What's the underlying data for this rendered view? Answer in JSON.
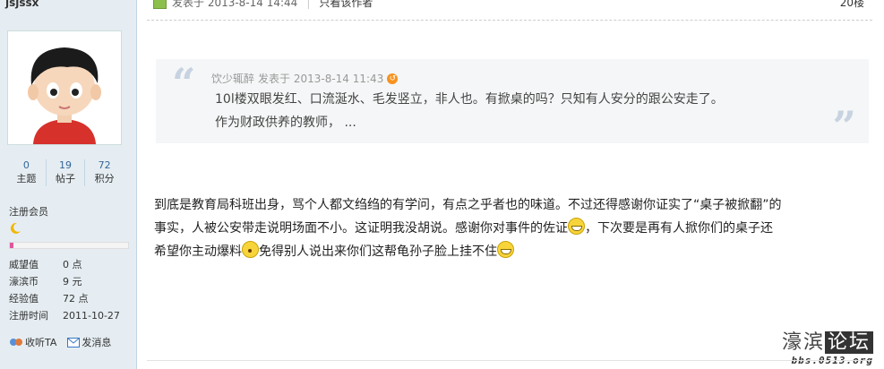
{
  "user": {
    "name": "jsjssx",
    "stats": [
      {
        "value": "0",
        "label": "主题"
      },
      {
        "value": "19",
        "label": "帖子"
      },
      {
        "value": "72",
        "label": "积分"
      }
    ],
    "group": "注册会员",
    "level_progress": 0.03,
    "info": [
      {
        "key": "威望值",
        "value": "0 点"
      },
      {
        "key": "濠滨币",
        "value": "9 元"
      },
      {
        "key": "经验值",
        "value": "72 点"
      },
      {
        "key": "注册时间",
        "value": "2011-10-27"
      }
    ],
    "actions": {
      "follow": "收听TA",
      "message": "发消息"
    }
  },
  "post": {
    "posted_at": "发表于 2013-8-14 14:44",
    "author_only": "只看该作者",
    "floor": "20楼",
    "quote": {
      "author": "饮少辄醉",
      "posted": "发表于 2013-8-14 11:43",
      "line1": "10l楼双眼发红、口流涎水、毛发竖立，非人也。有掀桌的吗？只知有人安分的跟公安走了。",
      "line2": "作为财政供养的教师，  ..."
    },
    "body": {
      "line1": "到底是教育局科班出身，骂个人都文绉绉的有学问，有点之乎者也的味道。不过还得感谢你证实了“桌子被掀翻”的",
      "line2a": "事实，人被公安带走说明场面不小。这证明我没胡说。感谢你对事件的佐证",
      "line2b": "，下次要是再有人掀你们的桌子还",
      "line3a": "希望你主动爆料",
      "line3b": "免得别人说出来你们这帮龟孙子脸上挂不住"
    }
  },
  "watermark": {
    "name": "濠滨",
    "box": "论坛",
    "url": "bbs.0513.org"
  }
}
